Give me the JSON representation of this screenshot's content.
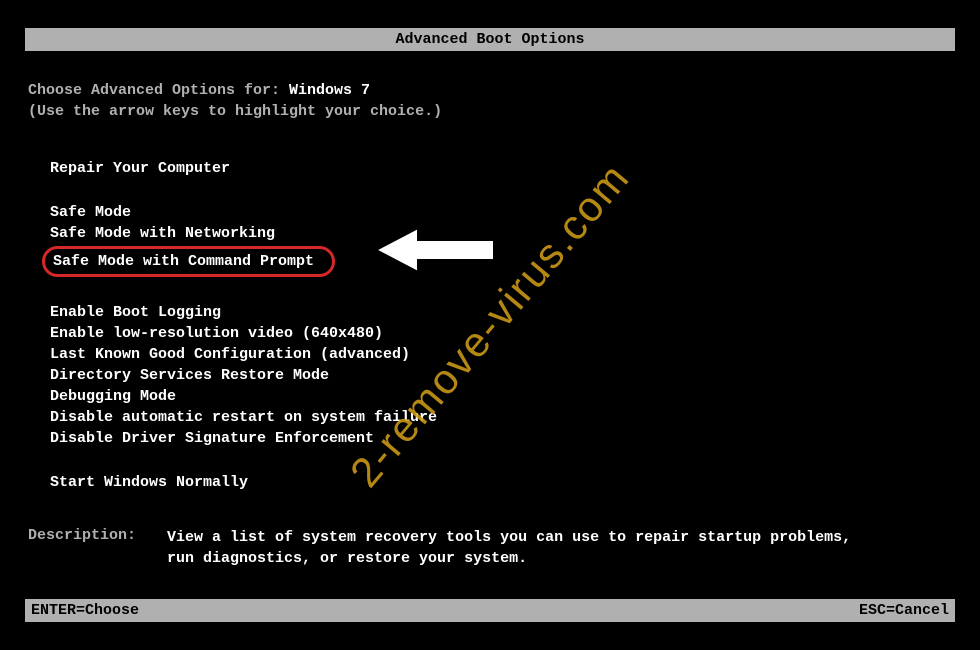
{
  "title": "Advanced Boot Options",
  "prompt": {
    "prefix": "Choose Advanced Options for: ",
    "os": "Windows 7",
    "hint": "(Use the arrow keys to highlight your choice.)"
  },
  "groups": {
    "repair": [
      "Repair Your Computer"
    ],
    "safe": [
      "Safe Mode",
      "Safe Mode with Networking",
      "Safe Mode with Command Prompt"
    ],
    "advanced": [
      "Enable Boot Logging",
      "Enable low-resolution video (640x480)",
      "Last Known Good Configuration (advanced)",
      "Directory Services Restore Mode",
      "Debugging Mode",
      "Disable automatic restart on system failure",
      "Disable Driver Signature Enforcement"
    ],
    "normal": [
      "Start Windows Normally"
    ]
  },
  "highlighted_option": "Safe Mode with Command Prompt",
  "description": {
    "label": "Description:",
    "text": "View a list of system recovery tools you can use to repair startup problems, run diagnostics, or restore your system."
  },
  "footer": {
    "enter": "ENTER=Choose",
    "esc": "ESC=Cancel"
  },
  "watermark": "2-remove-virus.com"
}
